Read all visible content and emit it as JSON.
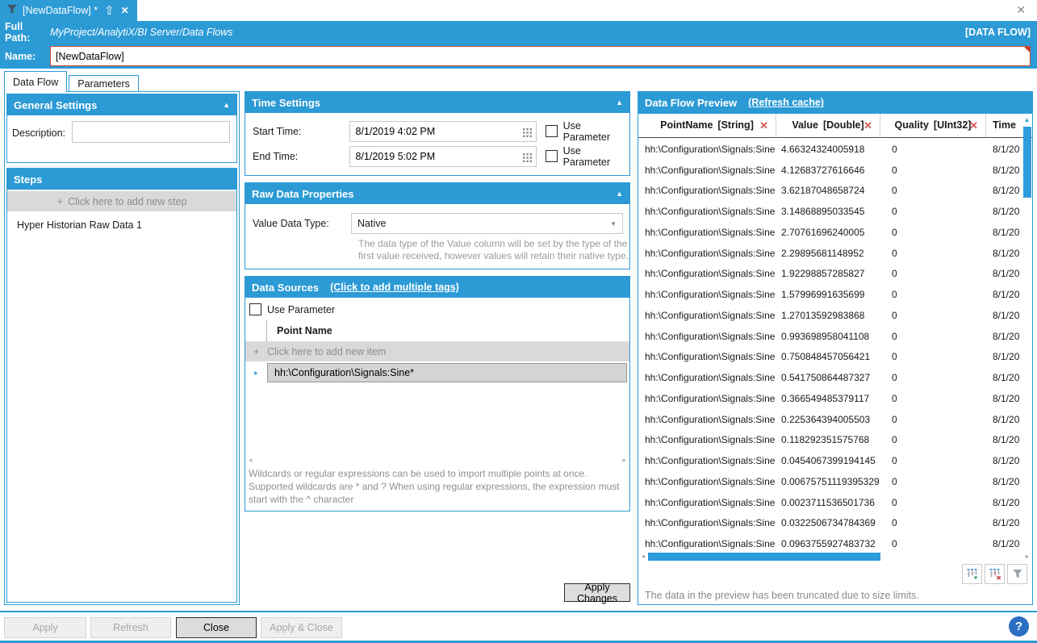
{
  "titlebar": {
    "tab_title": "[NewDataFlow] *"
  },
  "header": {
    "full_path_label": "Full Path:",
    "full_path_value": "MyProject/AnalytiX/BI Server/Data Flows",
    "context_badge": "[DATA FLOW]",
    "name_label": "Name:",
    "name_value": "[NewDataFlow]"
  },
  "tabs": [
    {
      "label": "Data Flow",
      "active": true
    },
    {
      "label": "Parameters",
      "active": false
    }
  ],
  "general_settings": {
    "title": "General Settings",
    "description_label": "Description:",
    "description_value": ""
  },
  "steps": {
    "title": "Steps",
    "add_label": "Click here to add new step",
    "items": [
      "Hyper Historian Raw Data  1"
    ]
  },
  "time_settings": {
    "title": "Time Settings",
    "start_label": "Start Time:",
    "start_value": "8/1/2019 4:02 PM",
    "end_label": "End Time:",
    "end_value": "8/1/2019 5:02 PM",
    "use_parameter_label": "Use Parameter"
  },
  "raw_data_properties": {
    "title": "Raw Data Properties",
    "value_data_type_label": "Value Data Type:",
    "value_data_type_value": "Native",
    "hint": "The data type of the Value column will be set by the type of the first value received, however values will retain their native type."
  },
  "data_sources": {
    "title": "Data Sources",
    "add_multiple_link": "(Click to add multiple tags)",
    "use_parameter_label": "Use Parameter",
    "column_header": "Point Name",
    "add_label": "Click here to add new item",
    "rows": [
      "hh:\\Configuration\\Signals:Sine*"
    ],
    "wildcard_note": "Wildcards or regular expressions can be used to import multiple points at once. Supported wildcards are * and ? When using regular expressions, the expression must start with the ^ character",
    "apply_changes_label": "Apply Changes"
  },
  "preview": {
    "title": "Data Flow Preview",
    "refresh_link": "(Refresh cache)",
    "columns": [
      {
        "label": "PointName",
        "type": "[String]",
        "removable": true
      },
      {
        "label": "Value",
        "type": "[Double]",
        "removable": true
      },
      {
        "label": "Quality",
        "type": "[UInt32]",
        "removable": true
      },
      {
        "label": "Time",
        "type": "",
        "removable": false
      }
    ],
    "rows": [
      {
        "point": "hh:\\Configuration\\Signals:Sine",
        "value": "4.66324324005918",
        "quality": "0",
        "time": "8/1/20"
      },
      {
        "point": "hh:\\Configuration\\Signals:Sine",
        "value": "4.12683727616646",
        "quality": "0",
        "time": "8/1/20"
      },
      {
        "point": "hh:\\Configuration\\Signals:Sine",
        "value": "3.62187048658724",
        "quality": "0",
        "time": "8/1/20"
      },
      {
        "point": "hh:\\Configuration\\Signals:Sine",
        "value": "3.14868895033545",
        "quality": "0",
        "time": "8/1/20"
      },
      {
        "point": "hh:\\Configuration\\Signals:Sine",
        "value": "2.70761696240005",
        "quality": "0",
        "time": "8/1/20"
      },
      {
        "point": "hh:\\Configuration\\Signals:Sine",
        "value": "2.29895681148952",
        "quality": "0",
        "time": "8/1/20"
      },
      {
        "point": "hh:\\Configuration\\Signals:Sine",
        "value": "1.92298857285827",
        "quality": "0",
        "time": "8/1/20"
      },
      {
        "point": "hh:\\Configuration\\Signals:Sine",
        "value": "1.57996991635699",
        "quality": "0",
        "time": "8/1/20"
      },
      {
        "point": "hh:\\Configuration\\Signals:Sine",
        "value": "1.27013592983868",
        "quality": "0",
        "time": "8/1/20"
      },
      {
        "point": "hh:\\Configuration\\Signals:Sine",
        "value": "0.993698958041108",
        "quality": "0",
        "time": "8/1/20"
      },
      {
        "point": "hh:\\Configuration\\Signals:Sine",
        "value": "0.750848457056421",
        "quality": "0",
        "time": "8/1/20"
      },
      {
        "point": "hh:\\Configuration\\Signals:Sine",
        "value": "0.541750864487327",
        "quality": "0",
        "time": "8/1/20"
      },
      {
        "point": "hh:\\Configuration\\Signals:Sine",
        "value": "0.366549485379117",
        "quality": "0",
        "time": "8/1/20"
      },
      {
        "point": "hh:\\Configuration\\Signals:Sine",
        "value": "0.225364394005503",
        "quality": "0",
        "time": "8/1/20"
      },
      {
        "point": "hh:\\Configuration\\Signals:Sine",
        "value": "0.118292351575768",
        "quality": "0",
        "time": "8/1/20"
      },
      {
        "point": "hh:\\Configuration\\Signals:Sine",
        "value": "0.0454067399194145",
        "quality": "0",
        "time": "8/1/20"
      },
      {
        "point": "hh:\\Configuration\\Signals:Sine",
        "value": "0.00675751119395329",
        "quality": "0",
        "time": "8/1/20"
      },
      {
        "point": "hh:\\Configuration\\Signals:Sine",
        "value": "0.0023711536501736",
        "quality": "0",
        "time": "8/1/20"
      },
      {
        "point": "hh:\\Configuration\\Signals:Sine",
        "value": "0.0322506734784369",
        "quality": "0",
        "time": "8/1/20"
      },
      {
        "point": "hh:\\Configuration\\Signals:Sine",
        "value": "0.0963755927483732",
        "quality": "0",
        "time": "8/1/20"
      }
    ],
    "truncated_note": "The data in the preview has been truncated due to size limits."
  },
  "footer": {
    "buttons": [
      {
        "label": "Apply",
        "enabled": false
      },
      {
        "label": "Refresh",
        "enabled": false
      },
      {
        "label": "Close",
        "enabled": true
      },
      {
        "label": "Apply & Close",
        "enabled": false
      }
    ],
    "help_label": "?"
  },
  "glyphs": {
    "collapse": "▲",
    "close": "✕",
    "promote": "⇧",
    "plus": "+",
    "row_expand": "▸",
    "scroll_left": "◂",
    "scroll_right": "▸",
    "scroll_up": "▲",
    "dropdown": "▼",
    "delete_x": "✕"
  },
  "colors": {
    "accent_blue": "#2B9AD5",
    "error_red": "#CB4B2E",
    "delete_red": "#D45B5B",
    "scrollbar_blue": "#2D9CDB"
  }
}
